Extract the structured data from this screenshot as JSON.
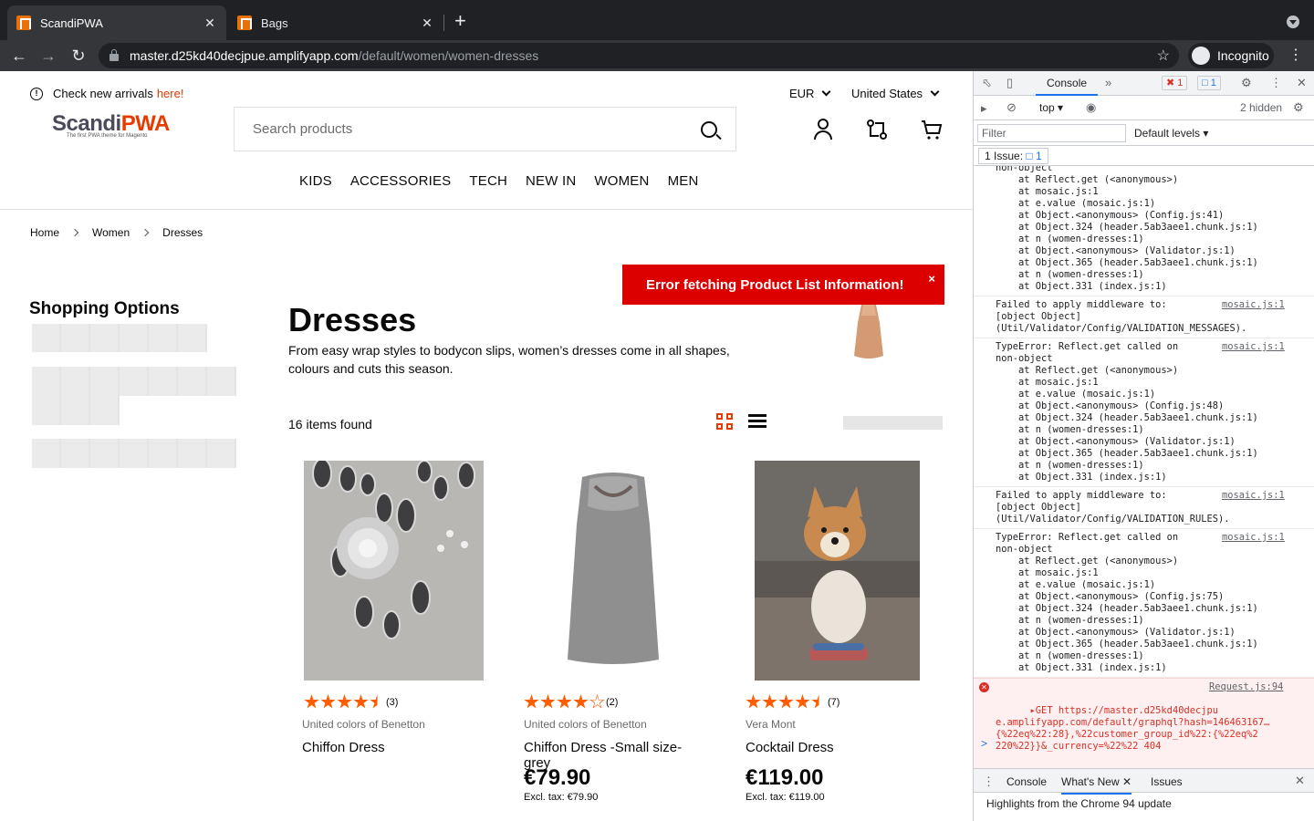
{
  "browser": {
    "tabs": [
      {
        "title": "ScandiPWA",
        "close": "✕"
      },
      {
        "title": "Bags",
        "close": "✕"
      }
    ],
    "new_tab": "+",
    "url_host": "master.d25kd40decjpue.amplifyapp.com",
    "url_path": "/default/women/women-dresses",
    "incognito_label": "Incognito"
  },
  "header": {
    "notice_text": "Check new arrivals",
    "notice_link": "here!",
    "currency": "EUR",
    "country": "United States",
    "logo_main": "Scandi",
    "logo_accent": "PWA",
    "logo_tagline": "The first PWA theme for Magento",
    "search_placeholder": "Search products",
    "menu": [
      "KIDS",
      "ACCESSORIES",
      "TECH",
      "NEW IN",
      "WOMEN",
      "MEN"
    ]
  },
  "breadcrumbs": [
    "Home",
    "Women",
    "Dresses"
  ],
  "sidebar": {
    "title": "Shopping Options"
  },
  "toast": {
    "message": "Error fetching Product List Information!",
    "close": "×"
  },
  "category": {
    "title": "Dresses",
    "description": "From easy wrap styles to bodycon slips, women’s dresses come in all shapes, colours and cuts this season.",
    "items_found": "16 items found"
  },
  "products": [
    {
      "rating": 4.5,
      "reviews": "(3)",
      "brand": "United colors of Benetton",
      "name": "Chiffon Dress",
      "price": "",
      "excl": ""
    },
    {
      "rating": 4,
      "reviews": "(2)",
      "brand": "United colors of Benetton",
      "name": "Chiffon Dress -Small size-grey",
      "price": "€79.90",
      "excl": "Excl. tax: €79.90"
    },
    {
      "rating": 4.5,
      "reviews": "(7)",
      "brand": "Vera Mont",
      "name": "Cocktail Dress",
      "price": "€119.00",
      "excl": "Excl. tax: €119.00"
    }
  ],
  "devtools": {
    "tab_console": "Console",
    "more": "»",
    "error_count": "1",
    "info_count": "1",
    "context": "top",
    "hidden": "2 hidden",
    "filter_placeholder": "Filter",
    "levels": "Default levels",
    "issues_label": "1 Issue:",
    "issues_count": "1",
    "log": [
      {
        "kind": "stack",
        "text": "non-object\n    at Reflect.get (<anonymous>)\n    at mosaic.js:1\n    at e.value (mosaic.js:1)\n    at Object.<anonymous> (Config.js:41)\n    at Object.324 (header.5ab3aee1.chunk.js:1)\n    at n (women-dresses:1)\n    at Object.<anonymous> (Validator.js:1)\n    at Object.365 (header.5ab3aee1.chunk.js:1)\n    at n (women-dresses:1)\n    at Object.331 (index.js:1)",
        "src": ""
      },
      {
        "kind": "warn",
        "text": "Failed to apply middleware to:\n[object Object]\n(Util/Validator/Config/VALIDATION_MESSAGES).",
        "src": "mosaic.js:1"
      },
      {
        "kind": "stack",
        "text": "TypeError: Reflect.get called on\nnon-object\n    at Reflect.get (<anonymous>)\n    at mosaic.js:1\n    at e.value (mosaic.js:1)\n    at Object.<anonymous> (Config.js:48)\n    at Object.324 (header.5ab3aee1.chunk.js:1)\n    at n (women-dresses:1)\n    at Object.<anonymous> (Validator.js:1)\n    at Object.365 (header.5ab3aee1.chunk.js:1)\n    at n (women-dresses:1)\n    at Object.331 (index.js:1)",
        "src": "mosaic.js:1"
      },
      {
        "kind": "warn",
        "text": "Failed to apply middleware to:\n[object Object]\n(Util/Validator/Config/VALIDATION_RULES).",
        "src": "mosaic.js:1"
      },
      {
        "kind": "stack",
        "text": "TypeError: Reflect.get called on\nnon-object\n    at Reflect.get (<anonymous>)\n    at mosaic.js:1\n    at e.value (mosaic.js:1)\n    at Object.<anonymous> (Config.js:75)\n    at Object.324 (header.5ab3aee1.chunk.js:1)\n    at n (women-dresses:1)\n    at Object.<anonymous> (Validator.js:1)\n    at Object.365 (header.5ab3aee1.chunk.js:1)\n    at n (women-dresses:1)\n    at Object.331 (index.js:1)",
        "src": "mosaic.js:1"
      }
    ],
    "error_line": "▸GET https://master.d25kd40decjpu\ne.amplifyapp.com/default/graphql?hash=146463167…\n{%22eq%22:28},%22customer_group_id%22:{%22eq%2\n220%22}}&_currency=%22%22 404",
    "error_src": "Request.js:94",
    "prompt": ">",
    "drawer_tabs": [
      "Console",
      "What's New",
      "Issues"
    ],
    "drawer_text": "Highlights from the Chrome 94 update"
  },
  "colors": {
    "accent": "#e73b00",
    "error": "#dc0000",
    "star": "#ff5c00"
  }
}
